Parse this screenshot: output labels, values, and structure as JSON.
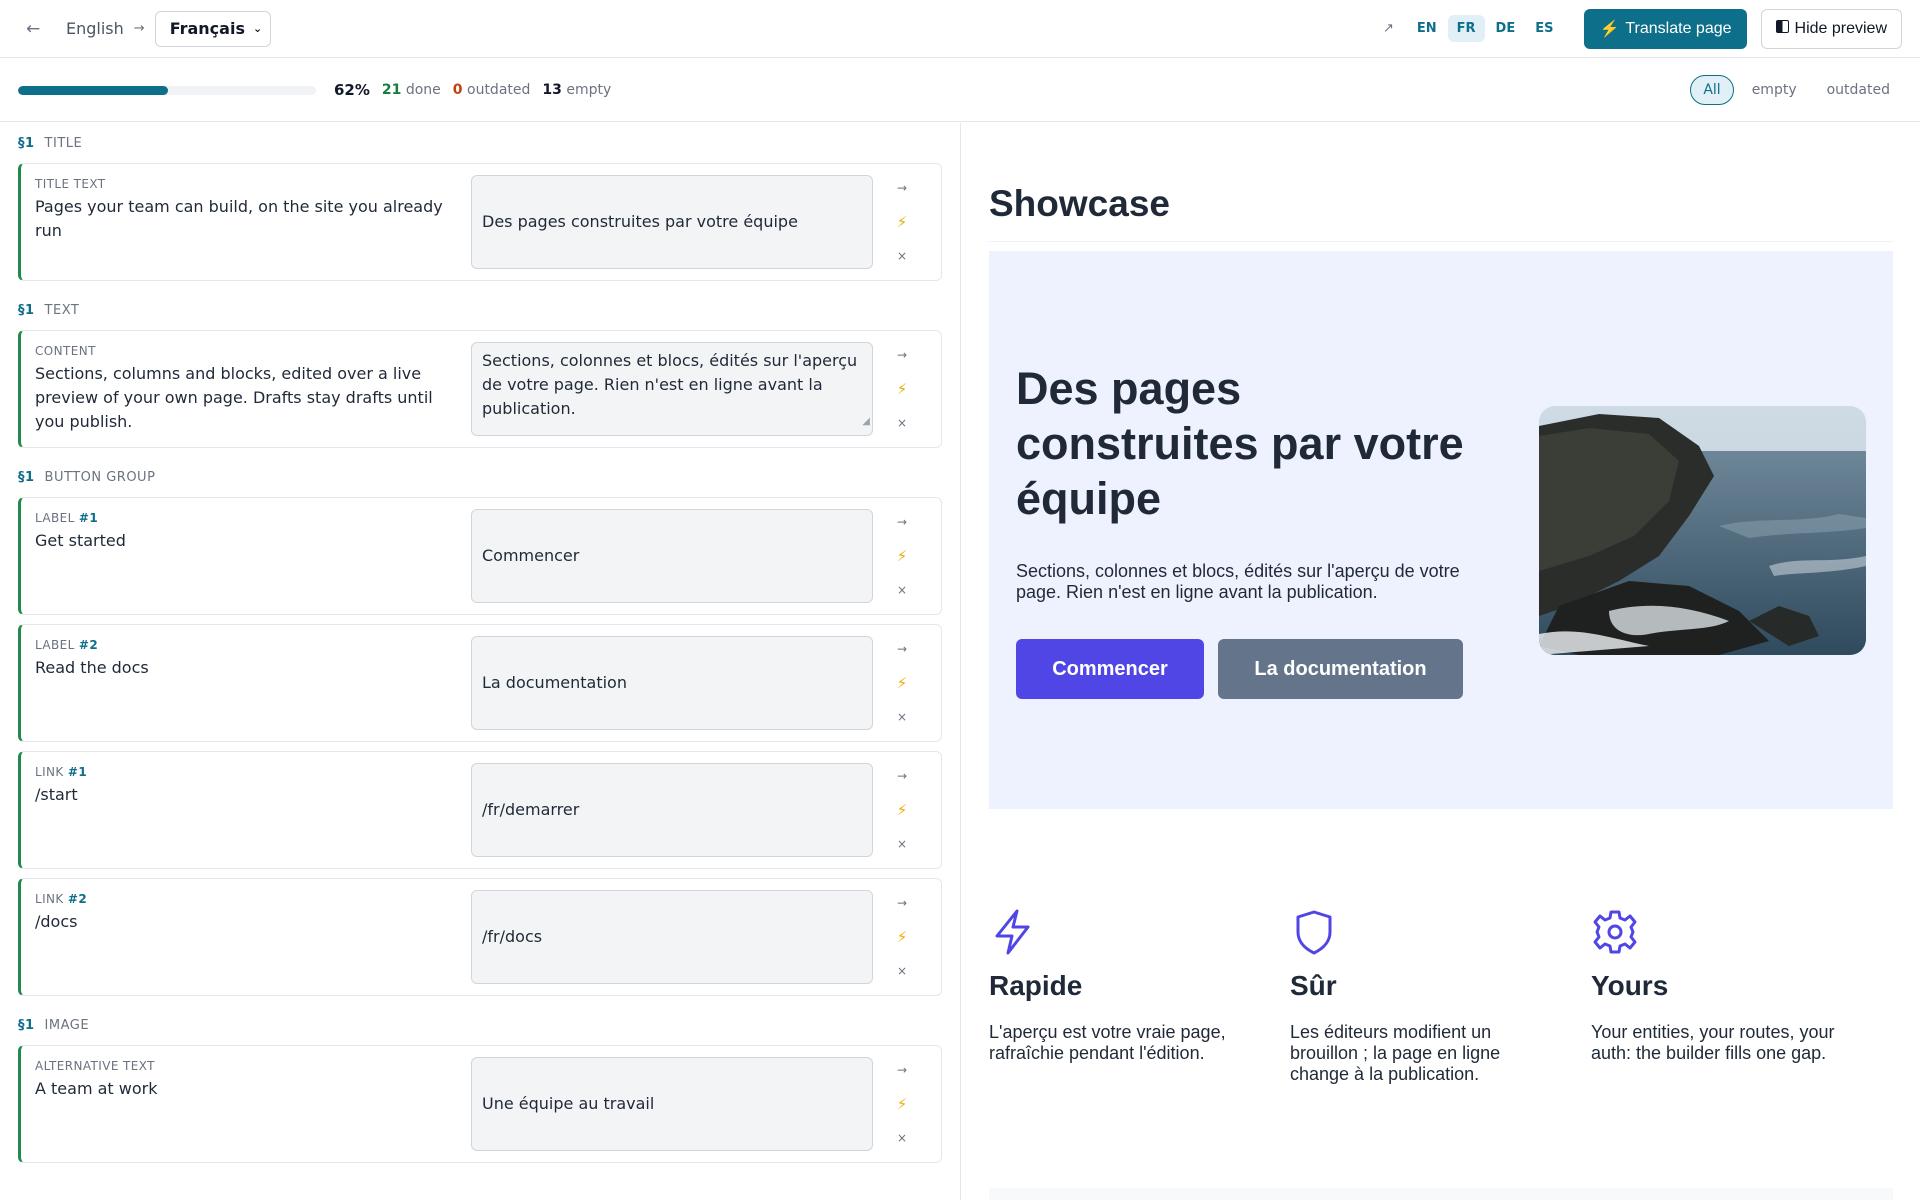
{
  "topbar": {
    "back_icon": "arrow-left-icon",
    "source_language": "English",
    "arrow": "→",
    "target_language": "Français",
    "languages": [
      "EN",
      "FR",
      "DE",
      "ES"
    ],
    "active_language": "FR",
    "translate_label": "Translate page",
    "hide_preview_label": "Hide preview"
  },
  "progress": {
    "percent_value": 0.62,
    "percent_label": "62%",
    "done_count": "21",
    "done_label": "done",
    "outdated_count": "0",
    "outdated_label": "outdated",
    "empty_count": "13",
    "empty_label": "empty",
    "filters": [
      "All",
      "empty",
      "outdated"
    ],
    "active_filter": "All"
  },
  "editor": {
    "sections": [
      {
        "num": "§1",
        "name": "TITLE",
        "fields": [
          {
            "label": "TITLE TEXT",
            "index": "",
            "source": "Pages your team can build, on the site you already run",
            "target": "Des pages construites par votre équipe"
          }
        ]
      },
      {
        "num": "§1",
        "name": "TEXT",
        "fields": [
          {
            "label": "CONTENT",
            "index": "",
            "source": "Sections, columns and blocks, edited over a live preview of your own page. Drafts stay drafts until you publish.",
            "target": "Sections, colonnes et blocs, édités sur l'aperçu de votre page. Rien n'est en ligne avant la publication."
          }
        ]
      },
      {
        "num": "§1",
        "name": "BUTTON GROUP",
        "fields": [
          {
            "label": "LABEL",
            "index": "#1",
            "source": "Get started",
            "target": "Commencer"
          },
          {
            "label": "LABEL",
            "index": "#2",
            "source": "Read the docs",
            "target": "La documentation"
          },
          {
            "label": "LINK",
            "index": "#1",
            "source": "/start",
            "target": "/fr/demarrer"
          },
          {
            "label": "LINK",
            "index": "#2",
            "source": "/docs",
            "target": "/fr/docs"
          }
        ]
      },
      {
        "num": "§1",
        "name": "IMAGE",
        "fields": [
          {
            "label": "ALTERNATIVE TEXT",
            "index": "",
            "source": "A team at work",
            "target": "Une équipe au travail"
          }
        ]
      }
    ],
    "actions": {
      "copy": "→",
      "translate": "⚡",
      "clear": "×"
    }
  },
  "preview": {
    "section_title": "Showcase",
    "hero": {
      "heading": "Des pages construites par votre équipe",
      "text": "Sections, colonnes et blocs, édités sur l'aperçu de votre page. Rien n'est en ligne avant la publication.",
      "primary_button": "Commencer",
      "secondary_button": "La documentation",
      "image_icon": "coastal-cliffs-photo"
    },
    "features": [
      {
        "icon": "lightning-icon",
        "title": "Rapide",
        "text": "L'aperçu est votre vraie page, rafraîchie pendant l'édition."
      },
      {
        "icon": "shield-icon",
        "title": "Sûr",
        "text": "Les éditeurs modifient un brouillon ; la page en ligne change à la publication."
      },
      {
        "icon": "gear-icon",
        "title": "Yours",
        "text": "Your entities, your routes, your auth: the builder fills one gap."
      }
    ]
  },
  "colors": {
    "accent": "#0e6f8a",
    "done": "#15803d",
    "outdated": "#c2410c",
    "hero_bg": "#eef2fe",
    "primary_button": "#4f46e5",
    "secondary_button": "#64748b",
    "bolt": "#e7b008"
  }
}
